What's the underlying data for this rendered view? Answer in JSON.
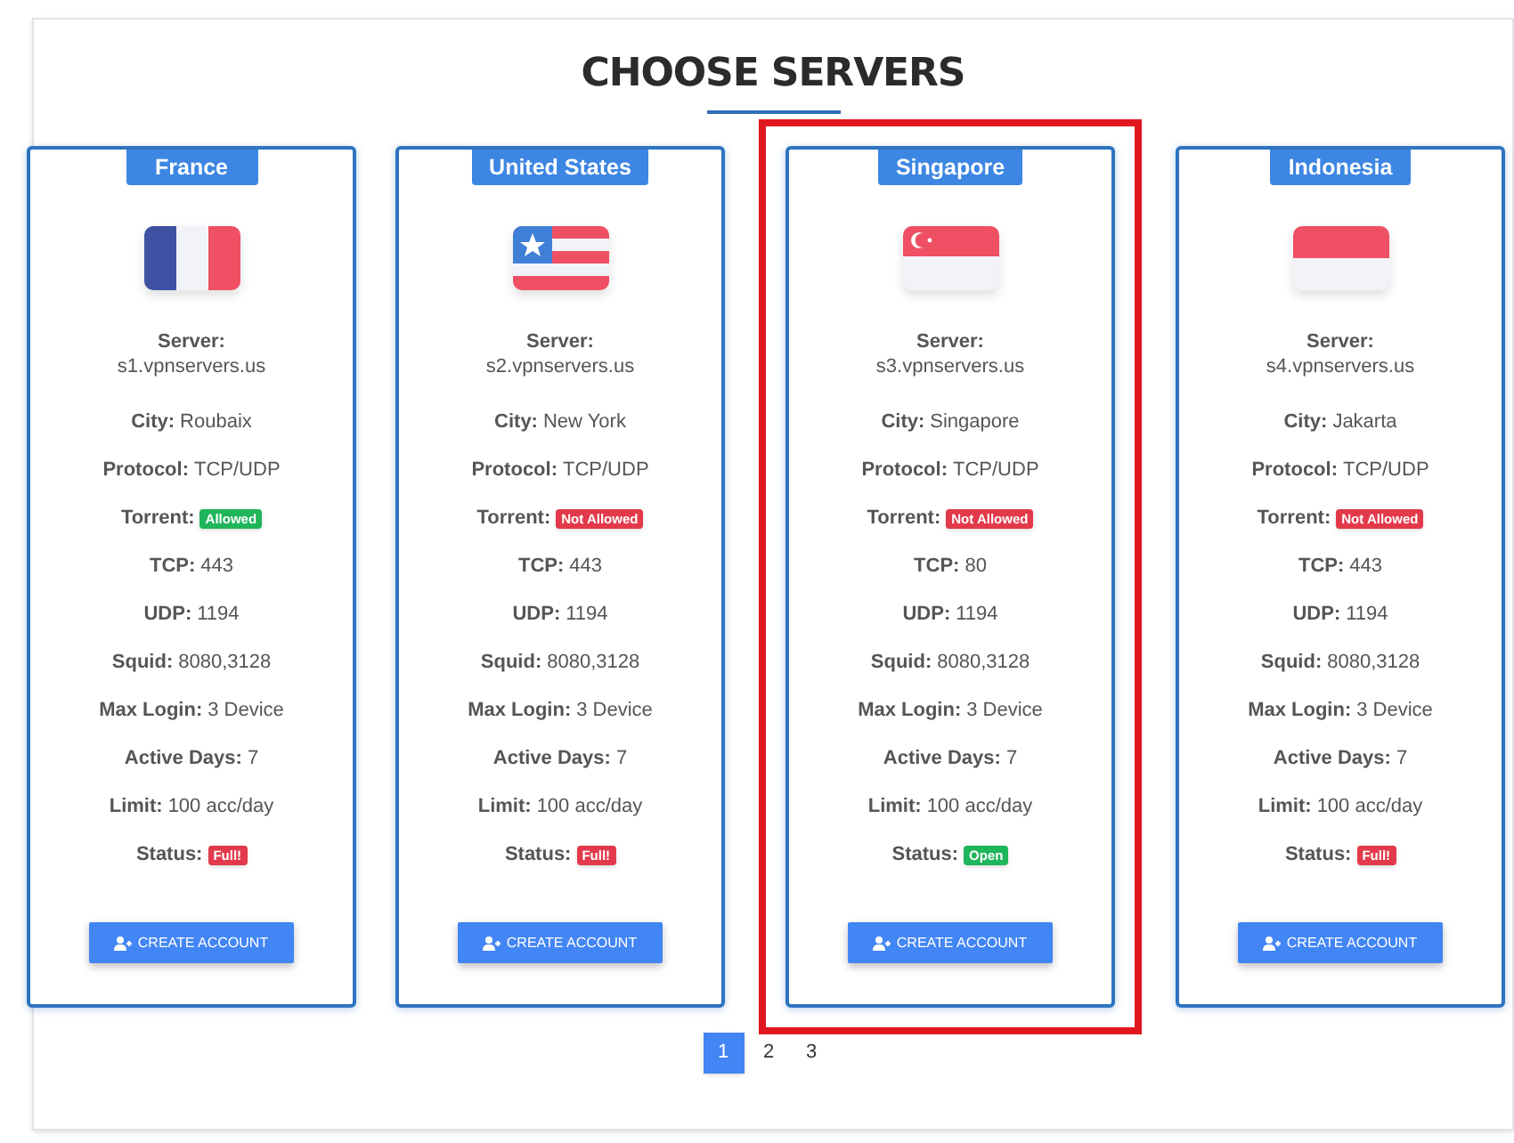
{
  "title": "CHOOSE SERVERS",
  "servers": [
    {
      "country": "France",
      "kind": "france",
      "selected": false,
      "rows": [
        {
          "label": "Server:",
          "value": "s1.vpnservers.us",
          "kind": "stacked"
        },
        {
          "label": "City:",
          "value": "Roubaix"
        },
        {
          "label": "Protocol:",
          "value": "TCP/UDP"
        },
        {
          "label": "Torrent:",
          "badge": "Allowed",
          "color": "#1fb55a"
        },
        {
          "label": "TCP:",
          "value": "443"
        },
        {
          "label": "UDP:",
          "value": "1194"
        },
        {
          "label": "Squid:",
          "value": "8080,3128"
        },
        {
          "label": "Max Login:",
          "value": "3 Device"
        },
        {
          "label": "Active Days:",
          "value": "7"
        },
        {
          "label": "Limit:",
          "value": "100 acc/day"
        },
        {
          "label": "Status:",
          "badge": "Full!",
          "color": "#e23a4a"
        }
      ],
      "button": "CREATE ACCOUNT"
    },
    {
      "country": "United States",
      "kind": "usa",
      "selected": false,
      "rows": [
        {
          "label": "Server:",
          "value": "s2.vpnservers.us",
          "kind": "stacked"
        },
        {
          "label": "City:",
          "value": "New York"
        },
        {
          "label": "Protocol:",
          "value": "TCP/UDP"
        },
        {
          "label": "Torrent:",
          "badge": "Not Allowed",
          "color": "#e23a4a"
        },
        {
          "label": "TCP:",
          "value": "443"
        },
        {
          "label": "UDP:",
          "value": "1194"
        },
        {
          "label": "Squid:",
          "value": "8080,3128"
        },
        {
          "label": "Max Login:",
          "value": "3 Device"
        },
        {
          "label": "Active Days:",
          "value": "7"
        },
        {
          "label": "Limit:",
          "value": "100 acc/day"
        },
        {
          "label": "Status:",
          "badge": "Full!",
          "color": "#e23a4a"
        }
      ],
      "button": "CREATE ACCOUNT"
    },
    {
      "country": "Singapore",
      "kind": "singapore",
      "selected": true,
      "rows": [
        {
          "label": "Server:",
          "value": "s3.vpnservers.us",
          "kind": "stacked"
        },
        {
          "label": "City:",
          "value": "Singapore"
        },
        {
          "label": "Protocol:",
          "value": "TCP/UDP"
        },
        {
          "label": "Torrent:",
          "badge": "Not Allowed",
          "color": "#e23a4a"
        },
        {
          "label": "TCP:",
          "value": "80"
        },
        {
          "label": "UDP:",
          "value": "1194"
        },
        {
          "label": "Squid:",
          "value": "8080,3128"
        },
        {
          "label": "Max Login:",
          "value": "3 Device"
        },
        {
          "label": "Active Days:",
          "value": "7"
        },
        {
          "label": "Limit:",
          "value": "100 acc/day"
        },
        {
          "label": "Status:",
          "badge": "Open",
          "color": "#1fb55a"
        }
      ],
      "button": "CREATE ACCOUNT"
    },
    {
      "country": "Indonesia",
      "kind": "indonesia",
      "selected": false,
      "rows": [
        {
          "label": "Server:",
          "value": "s4.vpnservers.us",
          "kind": "stacked"
        },
        {
          "label": "City:",
          "value": "Jakarta"
        },
        {
          "label": "Protocol:",
          "value": "TCP/UDP"
        },
        {
          "label": "Torrent:",
          "badge": "Not Allowed",
          "color": "#e23a4a"
        },
        {
          "label": "TCP:",
          "value": "443"
        },
        {
          "label": "UDP:",
          "value": "1194"
        },
        {
          "label": "Squid:",
          "value": "8080,3128"
        },
        {
          "label": "Max Login:",
          "value": "3 Device"
        },
        {
          "label": "Active Days:",
          "value": "7"
        },
        {
          "label": "Limit:",
          "value": "100 acc/day"
        },
        {
          "label": "Status:",
          "badge": "Full!",
          "color": "#e23a4a"
        }
      ],
      "button": "CREATE ACCOUNT"
    }
  ],
  "pages": [
    {
      "label": "1",
      "selected": true
    },
    {
      "label": "2",
      "selected": false
    },
    {
      "label": "3",
      "selected": false
    }
  ]
}
